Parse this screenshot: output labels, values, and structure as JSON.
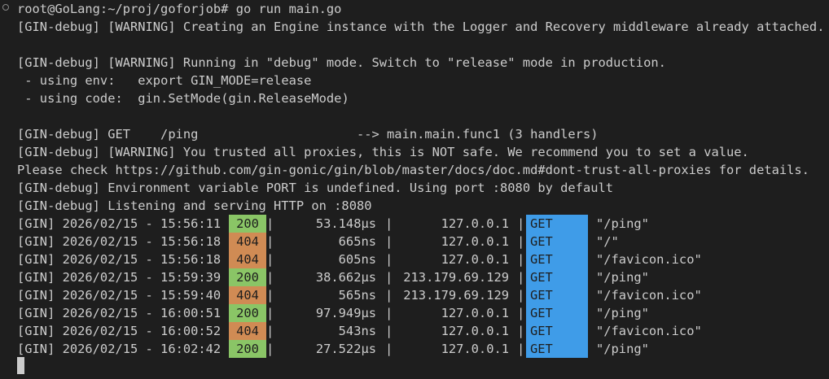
{
  "terminal": {
    "prompt_line": "root@GoLang:~/proj/goforjob# go run main.go",
    "output": [
      "[GIN-debug] [WARNING] Creating an Engine instance with the Logger and Recovery middleware already attached.",
      "",
      "[GIN-debug] [WARNING] Running in \"debug\" mode. Switch to \"release\" mode in production.",
      " - using env:\texport GIN_MODE=release",
      " - using code:\tgin.SetMode(gin.ReleaseMode)",
      "",
      "[GIN-debug] GET    /ping                     --> main.main.func1 (3 handlers)",
      "[GIN-debug] [WARNING] You trusted all proxies, this is NOT safe. We recommend you to set a value.",
      "Please check https://github.com/gin-gonic/gin/blob/master/docs/doc.md#dont-trust-all-proxies for details.",
      "[GIN-debug] Environment variable PORT is undefined. Using port :8080 by default",
      "[GIN-debug] Listening and serving HTTP on :8080"
    ],
    "log_prefix": "[GIN]",
    "separator": "|",
    "logs": [
      {
        "timestamp": "2026/02/15 - 15:56:11",
        "status": "200",
        "latency": "53.148µs",
        "ip": "127.0.0.1",
        "method": "GET",
        "path": "\"/ping\""
      },
      {
        "timestamp": "2026/02/15 - 15:56:18",
        "status": "404",
        "latency": "665ns",
        "ip": "127.0.0.1",
        "method": "GET",
        "path": "\"/\""
      },
      {
        "timestamp": "2026/02/15 - 15:56:18",
        "status": "404",
        "latency": "605ns",
        "ip": "127.0.0.1",
        "method": "GET",
        "path": "\"/favicon.ico\""
      },
      {
        "timestamp": "2026/02/15 - 15:59:39",
        "status": "200",
        "latency": "38.662µs",
        "ip": "213.179.69.129",
        "method": "GET",
        "path": "\"/ping\""
      },
      {
        "timestamp": "2026/02/15 - 15:59:40",
        "status": "404",
        "latency": "565ns",
        "ip": "213.179.69.129",
        "method": "GET",
        "path": "\"/favicon.ico\""
      },
      {
        "timestamp": "2026/02/15 - 16:00:51",
        "status": "200",
        "latency": "97.949µs",
        "ip": "127.0.0.1",
        "method": "GET",
        "path": "\"/ping\""
      },
      {
        "timestamp": "2026/02/15 - 16:00:52",
        "status": "404",
        "latency": "543ns",
        "ip": "127.0.0.1",
        "method": "GET",
        "path": "\"/favicon.ico\""
      },
      {
        "timestamp": "2026/02/15 - 16:02:42",
        "status": "200",
        "latency": "27.522µs",
        "ip": "127.0.0.1",
        "method": "GET",
        "path": "\"/ping\""
      }
    ],
    "colors": {
      "background": "#1e1e1e",
      "text": "#cccccc",
      "status_200": "#8ac566",
      "status_404": "#d08b54",
      "method_get": "#3f9ce8"
    }
  }
}
